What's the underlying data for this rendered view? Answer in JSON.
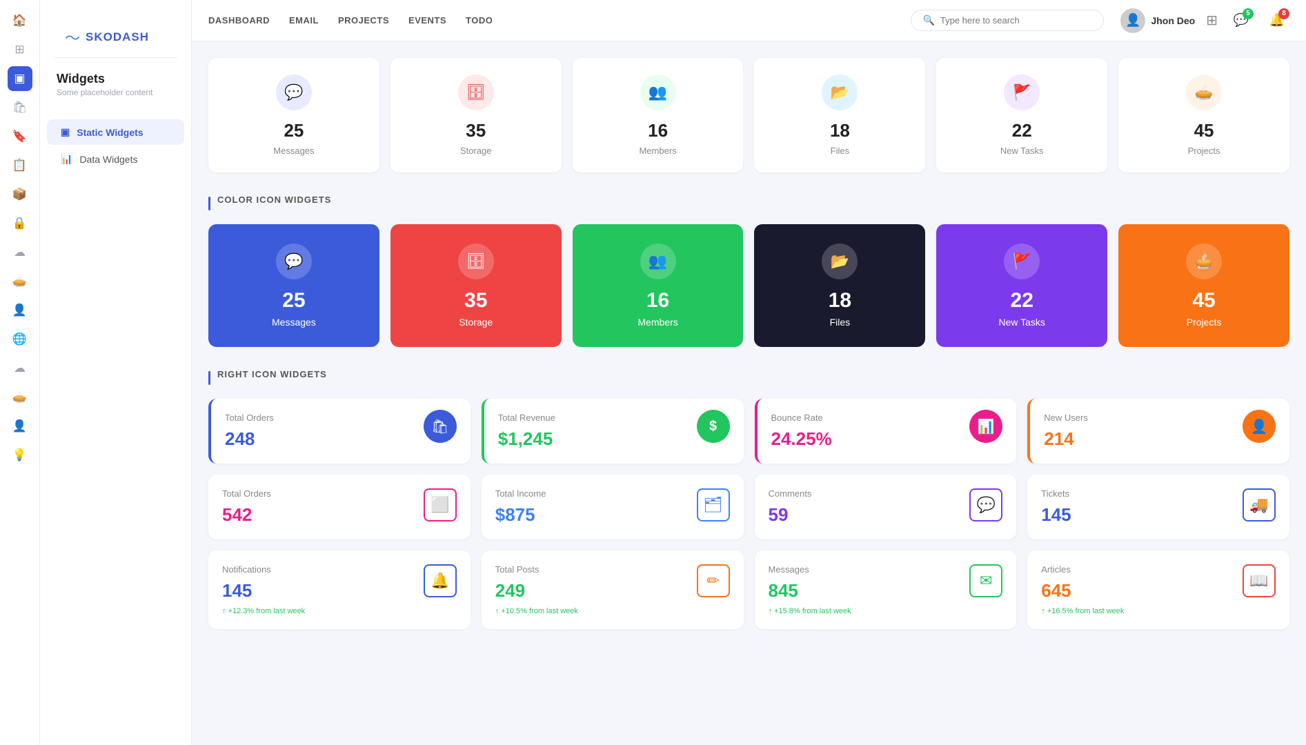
{
  "app": {
    "logo": "〜",
    "name": "SKODASH"
  },
  "topnav": {
    "links": [
      "DASHBOARD",
      "EMAIL",
      "PROJECTS",
      "EVENTS",
      "TODO"
    ],
    "search_placeholder": "Type here to search",
    "username": "Jhon Deo",
    "messenger_badge": "5",
    "notification_badge": "8"
  },
  "sidebar": {
    "title": "Widgets",
    "subtitle": "Some placeholder content",
    "items": [
      {
        "label": "Static Widgets",
        "active": true,
        "icon": "▣"
      },
      {
        "label": "Data Widgets",
        "active": false,
        "icon": "📊"
      }
    ]
  },
  "static_widgets": {
    "section_title": "",
    "cards": [
      {
        "icon": "💬",
        "icon_bg": "#e8eaff",
        "icon_color": "#5c6bc0",
        "value": "25",
        "label": "Messages"
      },
      {
        "icon": "🗄",
        "icon_bg": "#ffe8e8",
        "icon_color": "#e53e3e",
        "value": "35",
        "label": "Storage"
      },
      {
        "icon": "👥",
        "icon_bg": "#e8fff0",
        "icon_color": "#22c55e",
        "value": "16",
        "label": "Members"
      },
      {
        "icon": "📂",
        "icon_bg": "#e0f4ff",
        "icon_color": "#0ea5e9",
        "value": "18",
        "label": "Files"
      },
      {
        "icon": "🚩",
        "icon_bg": "#f3e8ff",
        "icon_color": "#9333ea",
        "value": "22",
        "label": "New Tasks"
      },
      {
        "icon": "🥧",
        "icon_bg": "#fff3e8",
        "icon_color": "#f97316",
        "value": "45",
        "label": "Projects"
      }
    ]
  },
  "color_widgets": {
    "section_title": "COLOR ICON WIDGETS",
    "cards": [
      {
        "bg": "#3b5bdb",
        "icon": "💬",
        "value": "25",
        "label": "Messages"
      },
      {
        "bg": "#ef4444",
        "icon": "🗄",
        "value": "35",
        "label": "Storage"
      },
      {
        "bg": "#22c55e",
        "icon": "👥",
        "value": "16",
        "label": "Members"
      },
      {
        "bg": "#1a1a2e",
        "icon": "📂",
        "value": "18",
        "label": "Files"
      },
      {
        "bg": "#7c3aed",
        "icon": "🚩",
        "value": "22",
        "label": "New Tasks"
      },
      {
        "bg": "#f97316",
        "icon": "🥧",
        "value": "45",
        "label": "Projects"
      }
    ]
  },
  "right_widgets": {
    "section_title": "RIGHT ICON WIDGETS",
    "row1": [
      {
        "label": "Total Orders",
        "value": "248",
        "value_color": "#3b5bdb",
        "icon": "🛍",
        "icon_bg": "#3b5bdb",
        "border_color": "#3b5bdb"
      },
      {
        "label": "Total Revenue",
        "value": "$1,245",
        "value_color": "#22c55e",
        "icon": "$",
        "icon_bg": "#22c55e",
        "border_color": "#22c55e"
      },
      {
        "label": "Bounce Rate",
        "value": "24.25%",
        "value_color": "#e91e8c",
        "icon": "📊",
        "icon_bg": "#e91e8c",
        "border_color": "#e91e8c"
      },
      {
        "label": "New Users",
        "value": "214",
        "value_color": "#f97316",
        "icon": "👤",
        "icon_bg": "#f97316",
        "border_color": "#f97316"
      }
    ],
    "row2": [
      {
        "label": "Total Orders",
        "value": "542",
        "value_color": "#e91e8c",
        "icon": "⬜",
        "icon_color": "#e91e8c",
        "border_color": "#e91e8c"
      },
      {
        "label": "Total Income",
        "value": "$875",
        "value_color": "#3b82f6",
        "icon": "🗂",
        "icon_color": "#3b82f6",
        "border_color": "#3b82f6"
      },
      {
        "label": "Comments",
        "value": "59",
        "value_color": "#7c3aed",
        "icon": "💬",
        "icon_color": "#7c3aed",
        "border_color": "#7c3aed"
      },
      {
        "label": "Tickets",
        "value": "145",
        "value_color": "#3b5bdb",
        "icon": "🚚",
        "icon_color": "#3b5bdb",
        "border_color": "#3b5bdb"
      }
    ],
    "row3": [
      {
        "label": "Notifications",
        "value": "145",
        "value_color": "#3b5bdb",
        "icon": "🔔",
        "icon_color": "#3b5bdb",
        "border_color": "#3b5bdb",
        "change": "↑ +12.3% from last week",
        "change_positive": true
      },
      {
        "label": "Total Posts",
        "value": "249",
        "value_color": "#22c55e",
        "icon": "✏",
        "icon_color": "#f97316",
        "border_color": "#f97316",
        "change": "↑ +10.5% from last week",
        "change_positive": true
      },
      {
        "label": "Messages",
        "value": "845",
        "value_color": "#22c55e",
        "icon": "✉",
        "icon_color": "#22c55e",
        "border_color": "#22c55e",
        "change": "↑ +15.8% from last week",
        "change_positive": true
      },
      {
        "label": "Articles",
        "value": "645",
        "value_color": "#f97316",
        "icon": "📖",
        "icon_color": "#ef4444",
        "border_color": "#ef4444",
        "change": "↑ +16.5% from last week",
        "change_positive": true
      }
    ]
  },
  "icon_nav": [
    {
      "icon": "🏠",
      "name": "home",
      "active": false
    },
    {
      "icon": "⊞",
      "name": "grid",
      "active": false
    },
    {
      "icon": "●",
      "name": "circle-blue",
      "active": true
    },
    {
      "icon": "🛍",
      "name": "shop",
      "active": false
    },
    {
      "icon": "🔖",
      "name": "bookmark",
      "active": false
    },
    {
      "icon": "📋",
      "name": "clipboard",
      "active": false
    },
    {
      "icon": "📦",
      "name": "box",
      "active": false
    },
    {
      "icon": "🔒",
      "name": "lock",
      "active": false
    },
    {
      "icon": "☁",
      "name": "cloud",
      "active": false
    },
    {
      "icon": "🥧",
      "name": "pie",
      "active": false
    },
    {
      "icon": "👤",
      "name": "user",
      "active": false
    },
    {
      "icon": "🌐",
      "name": "globe",
      "active": false
    },
    {
      "icon": "☁",
      "name": "cloud2",
      "active": false
    },
    {
      "icon": "🥧",
      "name": "pie2",
      "active": false
    },
    {
      "icon": "👤",
      "name": "user2",
      "active": false
    },
    {
      "icon": "💡",
      "name": "info",
      "active": false
    }
  ]
}
